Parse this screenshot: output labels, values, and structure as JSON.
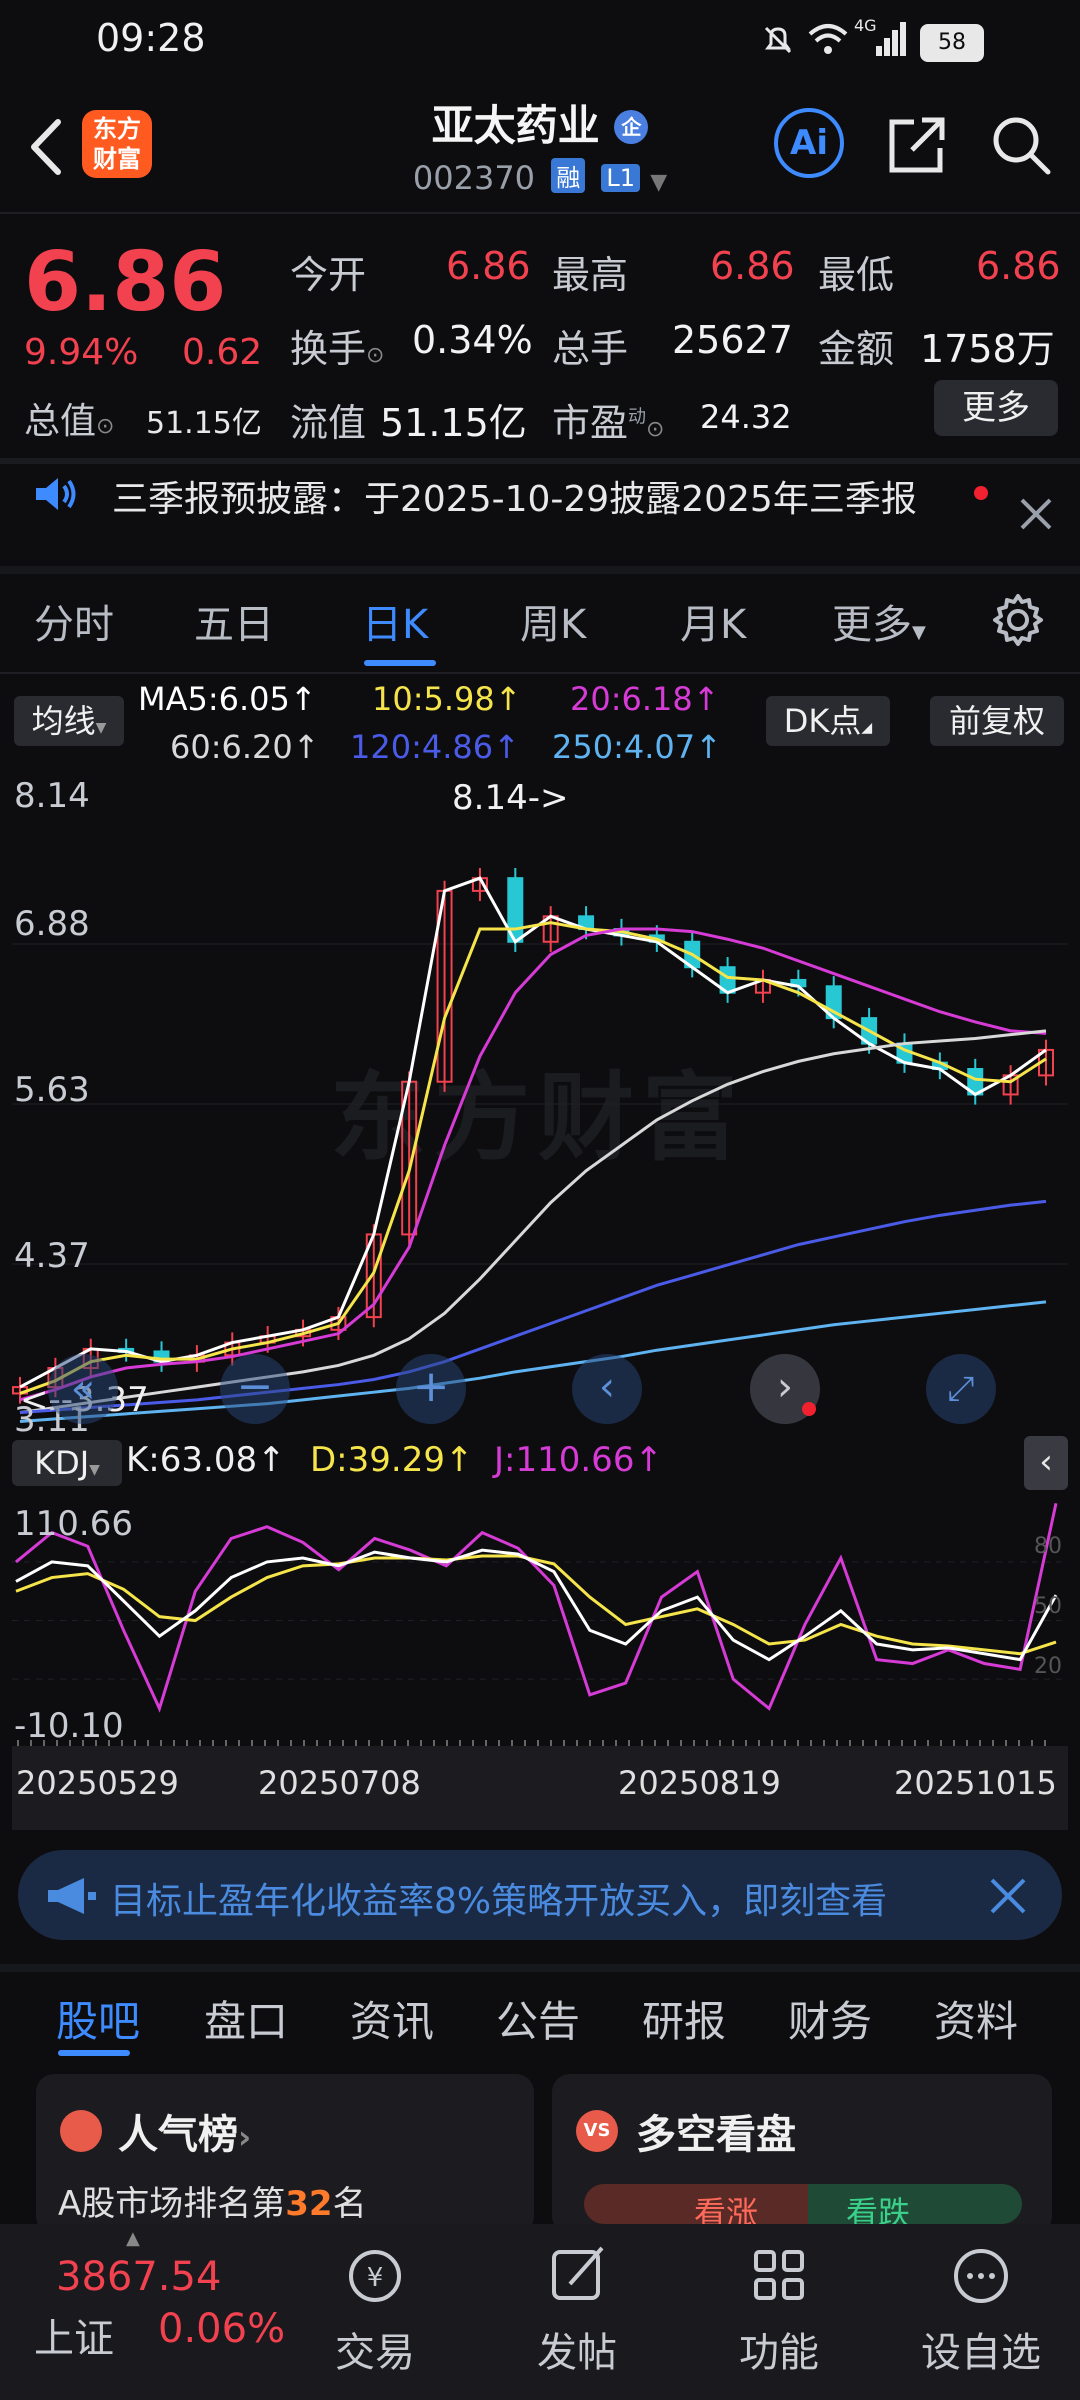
{
  "status": {
    "time": "09:28",
    "battery": "58",
    "network": "4G"
  },
  "header": {
    "logo": "东方\n财富",
    "logo_line1": "东方",
    "logo_line2": "财富",
    "title": "亚太药业",
    "title_badge": "企",
    "code": "002370",
    "tag_margin": "融",
    "tag_level": "L1",
    "ai_label": "Ai"
  },
  "quote": {
    "price": "6.86",
    "change_pct": "9.94%",
    "change_amt": "0.62",
    "open_label": "今开",
    "open": "6.86",
    "high_label": "最高",
    "high": "6.86",
    "low_label": "最低",
    "low": "6.86",
    "turnover_label": "换手",
    "turnover": "0.34%",
    "volume_label": "总手",
    "volume": "25627",
    "amount_label": "金额",
    "amount": "1758万",
    "mcap_label": "总值",
    "mcap": "51.15亿",
    "float_label": "流值",
    "float": "51.15亿",
    "pe_label": "市盈",
    "pe_sup": "动",
    "pe": "24.32",
    "more_label": "更多"
  },
  "notice": {
    "text": "三季报预披露：于2025-10-29披露2025年三季报"
  },
  "tabs": [
    "分时",
    "五日",
    "日K",
    "周K",
    "月K",
    "更多"
  ],
  "ma": {
    "button": "均线",
    "ma5": "MA5:6.05↑",
    "ma10": "10:5.98↑",
    "ma20": "20:6.18↑",
    "ma60": "60:6.20↑",
    "ma120": "120:4.86↑",
    "ma250": "250:4.07↑",
    "dk_button": "DK点",
    "fq_button": "前复权"
  },
  "colors": {
    "red": "#f2414f",
    "cyan": "#27c7d4",
    "ma5": "#ffffff",
    "ma10": "#f5e44a",
    "ma20": "#d63bd6",
    "ma60": "#d8d8d8",
    "ma120": "#4a5be8",
    "ma250": "#5fb3f0",
    "accent": "#3d8bff"
  },
  "chart_data": {
    "type": "line",
    "title": "",
    "y_ticks": [
      "8.14",
      "6.88",
      "5.63",
      "4.37",
      "3.11"
    ],
    "ylim": [
      3.11,
      8.14
    ],
    "annotations": [
      "8.14->",
      "<--3.37"
    ],
    "x_ticks": [
      "20250529",
      "20250708",
      "20250819",
      "20251015"
    ],
    "series": [
      {
        "name": "MA5",
        "values": [
          3.4,
          3.55,
          3.7,
          3.68,
          3.6,
          3.65,
          3.75,
          3.8,
          3.85,
          3.95,
          4.6,
          5.8,
          7.3,
          7.4,
          6.9,
          7.1,
          7.0,
          6.95,
          6.9,
          6.7,
          6.5,
          6.6,
          6.55,
          6.3,
          6.1,
          5.95,
          5.9,
          5.7,
          5.85,
          6.05
        ]
      },
      {
        "name": "10",
        "values": [
          3.35,
          3.45,
          3.6,
          3.65,
          3.62,
          3.62,
          3.7,
          3.75,
          3.82,
          3.9,
          4.3,
          5.1,
          6.3,
          7.0,
          7.0,
          7.05,
          7.0,
          6.98,
          6.92,
          6.8,
          6.62,
          6.6,
          6.5,
          6.35,
          6.2,
          6.05,
          5.95,
          5.82,
          5.8,
          5.98
        ]
      },
      {
        "name": "20",
        "values": [
          3.3,
          3.38,
          3.48,
          3.55,
          3.58,
          3.6,
          3.64,
          3.7,
          3.76,
          3.82,
          4.05,
          4.5,
          5.3,
          6.0,
          6.5,
          6.8,
          6.95,
          7.0,
          7.0,
          6.98,
          6.92,
          6.85,
          6.75,
          6.65,
          6.55,
          6.45,
          6.35,
          6.27,
          6.2,
          6.18
        ]
      },
      {
        "name": "60",
        "values": [
          3.2,
          3.24,
          3.28,
          3.32,
          3.36,
          3.4,
          3.44,
          3.48,
          3.52,
          3.57,
          3.65,
          3.78,
          3.98,
          4.25,
          4.55,
          4.85,
          5.1,
          5.3,
          5.5,
          5.65,
          5.78,
          5.88,
          5.96,
          6.02,
          6.06,
          6.1,
          6.12,
          6.14,
          6.17,
          6.2
        ]
      },
      {
        "name": "120",
        "values": [
          3.2,
          3.22,
          3.24,
          3.26,
          3.28,
          3.3,
          3.33,
          3.36,
          3.39,
          3.42,
          3.46,
          3.52,
          3.6,
          3.7,
          3.8,
          3.9,
          4.0,
          4.1,
          4.2,
          4.28,
          4.36,
          4.44,
          4.52,
          4.58,
          4.64,
          4.7,
          4.75,
          4.79,
          4.83,
          4.86
        ]
      },
      {
        "name": "250",
        "values": [
          3.13,
          3.15,
          3.17,
          3.19,
          3.21,
          3.23,
          3.25,
          3.27,
          3.3,
          3.33,
          3.36,
          3.39,
          3.43,
          3.47,
          3.52,
          3.56,
          3.6,
          3.64,
          3.69,
          3.73,
          3.77,
          3.81,
          3.85,
          3.89,
          3.92,
          3.95,
          3.98,
          4.01,
          4.04,
          4.07
        ]
      }
    ],
    "kdj": {
      "k": "K:63.08↑",
      "d": "D:39.29↑",
      "j": "J:110.66↑",
      "y_ticks": [
        "110.66",
        "-10.10"
      ],
      "right_ticks": [
        "80",
        "50",
        "20"
      ],
      "ylim": [
        -10.1,
        110.66
      ],
      "K": [
        70,
        80,
        78,
        60,
        42,
        55,
        72,
        80,
        82,
        78,
        85,
        82,
        80,
        86,
        84,
        75,
        45,
        38,
        55,
        62,
        40,
        30,
        42,
        55,
        38,
        35,
        36,
        33,
        30,
        63
      ],
      "D": [
        65,
        72,
        74,
        66,
        52,
        50,
        62,
        72,
        78,
        79,
        82,
        82,
        81,
        83,
        83,
        79,
        62,
        48,
        52,
        56,
        48,
        38,
        40,
        48,
        42,
        38,
        37,
        35,
        33,
        39
      ],
      "J": [
        80,
        95,
        88,
        45,
        5,
        65,
        92,
        98,
        90,
        76,
        92,
        86,
        78,
        95,
        87,
        68,
        12,
        18,
        62,
        75,
        20,
        5,
        48,
        82,
        30,
        28,
        35,
        28,
        25,
        110
      ]
    }
  },
  "kdj_button": "KDJ",
  "ad": {
    "text": "目标止盈年化收益率8%策略开放买入，即刻查看"
  },
  "bottom_tabs": [
    "股吧",
    "盘口",
    "资讯",
    "公告",
    "研报",
    "财务",
    "资料"
  ],
  "cards": {
    "rank": {
      "title": "人气榜",
      "sub_prefix": "A股市场排名第",
      "sub_num": "32",
      "sub_suffix": "名"
    },
    "vs": {
      "title": "多空看盘",
      "bull": "看涨",
      "bear": "看跌"
    }
  },
  "bottom_bar": {
    "index_value": "3867.54",
    "index_name": "上证",
    "index_change": "0.06%",
    "items": [
      "交易",
      "发帖",
      "功能",
      "设自选"
    ]
  }
}
